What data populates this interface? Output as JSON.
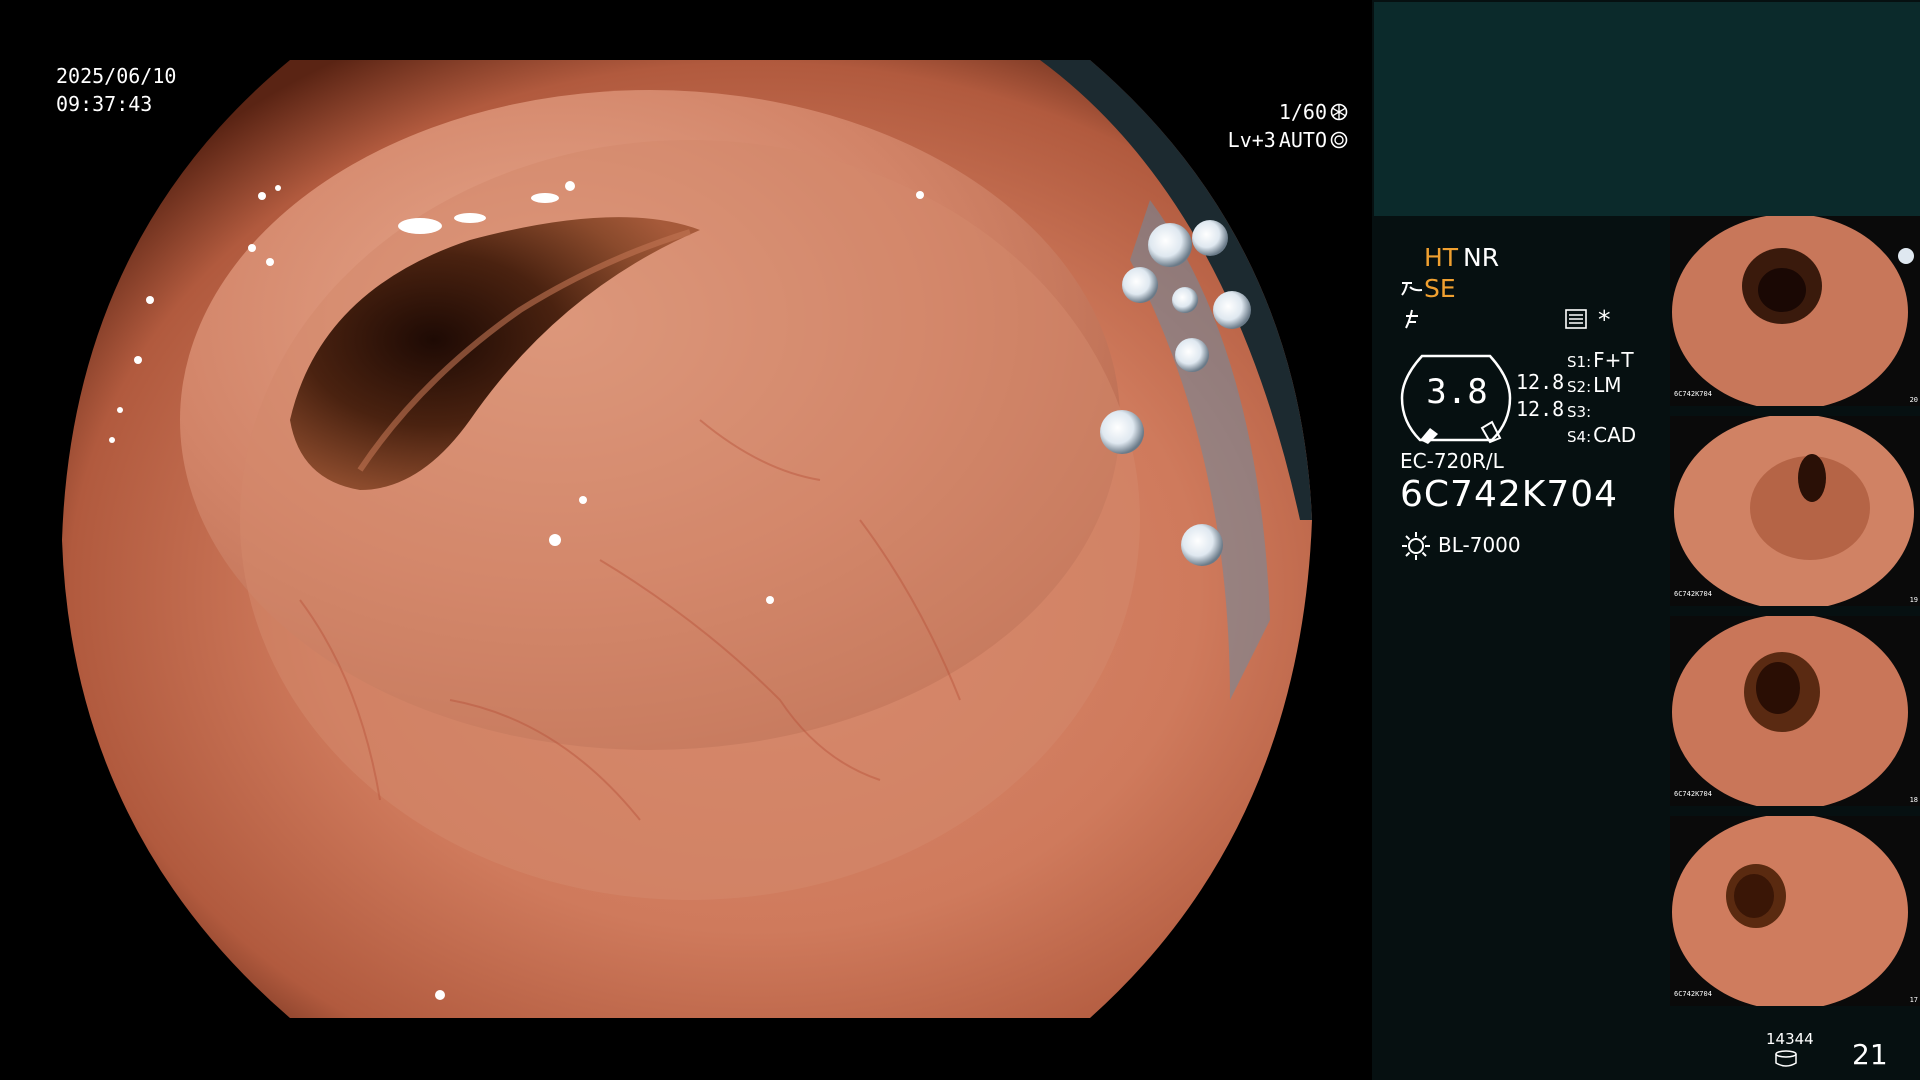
{
  "main_view": {
    "date": "2025/06/10",
    "time": "09:37:43",
    "shutter": "1/60",
    "enhancement_level": "Lv+3",
    "iris_mode": "AUTO"
  },
  "panel": {
    "modes": {
      "ht": "HT",
      "nr": "NR",
      "se": "SE"
    },
    "status_star": "*",
    "dial_value": "3.8",
    "side_values": [
      "12.8",
      "12.8"
    ],
    "switches": [
      {
        "key": "S1:",
        "value": "F+T"
      },
      {
        "key": "S2:",
        "value": "LM"
      },
      {
        "key": "S3:",
        "value": ""
      },
      {
        "key": "S4:",
        "value": "CAD"
      }
    ],
    "scope_model": "EC-720R/L",
    "scope_serial": "6C742K704",
    "light_source": "BL-7000",
    "storage_count": "14344",
    "frame_number": "21",
    "colors": {
      "accent": "#f0a030",
      "panel_bg": "#061011",
      "panel_top_bg": "#0b2a2b"
    }
  },
  "thumbnails": [
    {
      "index": 1,
      "caption": "6C742K704",
      "counter": "20"
    },
    {
      "index": 2,
      "caption": "6C742K704",
      "counter": "19"
    },
    {
      "index": 3,
      "caption": "6C742K704",
      "counter": "18"
    },
    {
      "index": 4,
      "caption": "6C742K704",
      "counter": "17"
    }
  ]
}
